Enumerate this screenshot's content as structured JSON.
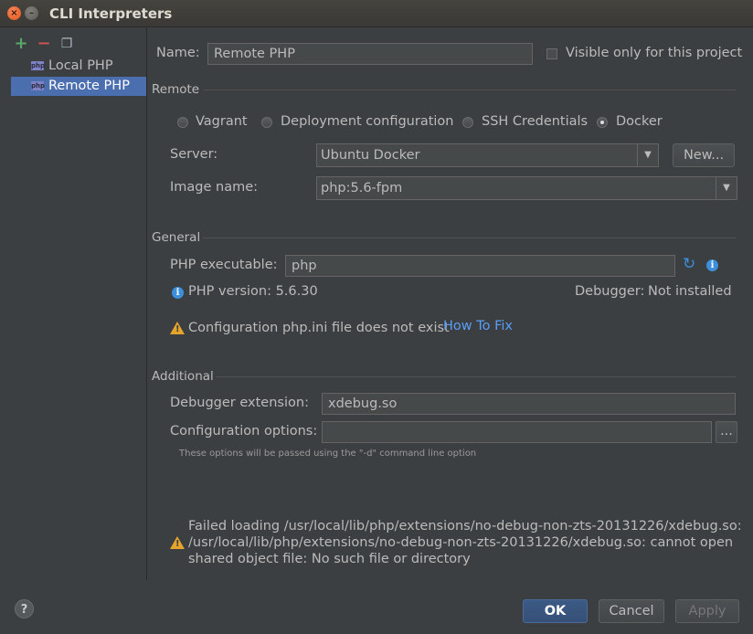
{
  "window": {
    "title": "CLI Interpreters"
  },
  "toolbar": {
    "add_icon": "+",
    "remove_icon": "−",
    "copy_icon": "❐"
  },
  "tree": {
    "items": [
      {
        "label": "Local PHP",
        "selected": false
      },
      {
        "label": "Remote PHP",
        "selected": true
      }
    ]
  },
  "form": {
    "name_label": "Name:",
    "name_value": "Remote PHP",
    "visible_only_label": "Visible only for this project",
    "remote_section": "Remote",
    "remote_options": {
      "vagrant": "Vagrant",
      "deployment": "Deployment configuration",
      "ssh": "SSH Credentials",
      "docker": "Docker",
      "selected": "Docker"
    },
    "server_label": "Server:",
    "server_value": "Ubuntu Docker",
    "new_button": "New...",
    "image_label": "Image name:",
    "image_value": "php:5.6-fpm",
    "general_section": "General",
    "php_exec_label": "PHP executable:",
    "php_exec_value": "php",
    "php_version": "PHP version: 5.6.30",
    "debugger_label": "Debugger:",
    "debugger_value": "Not installed",
    "config_warning": "Configuration php.ini file does not exist",
    "how_to_fix": "How To Fix",
    "additional_section": "Additional",
    "debugger_ext_label": "Debugger extension:",
    "debugger_ext_value": "xdebug.so",
    "config_options_label": "Configuration options:",
    "config_options_value": "",
    "browse_button": "...",
    "hint_text": "These options will be passed using the \"-d\" command line option",
    "error_line1": "Failed loading /usr/local/lib/php/extensions/no-debug-non-zts-20131226/xdebug.so:",
    "error_line2": "/usr/local/lib/php/extensions/no-debug-non-zts-20131226/xdebug.so: cannot open",
    "error_line3": "shared object file: No such file or directory"
  },
  "footer": {
    "help": "?",
    "ok": "OK",
    "cancel": "Cancel",
    "apply": "Apply"
  },
  "colors": {
    "background": "#3c3f41",
    "selection": "#4b6eaf",
    "link": "#589df6",
    "warning": "#e5a42b",
    "info": "#3d8fdb"
  }
}
